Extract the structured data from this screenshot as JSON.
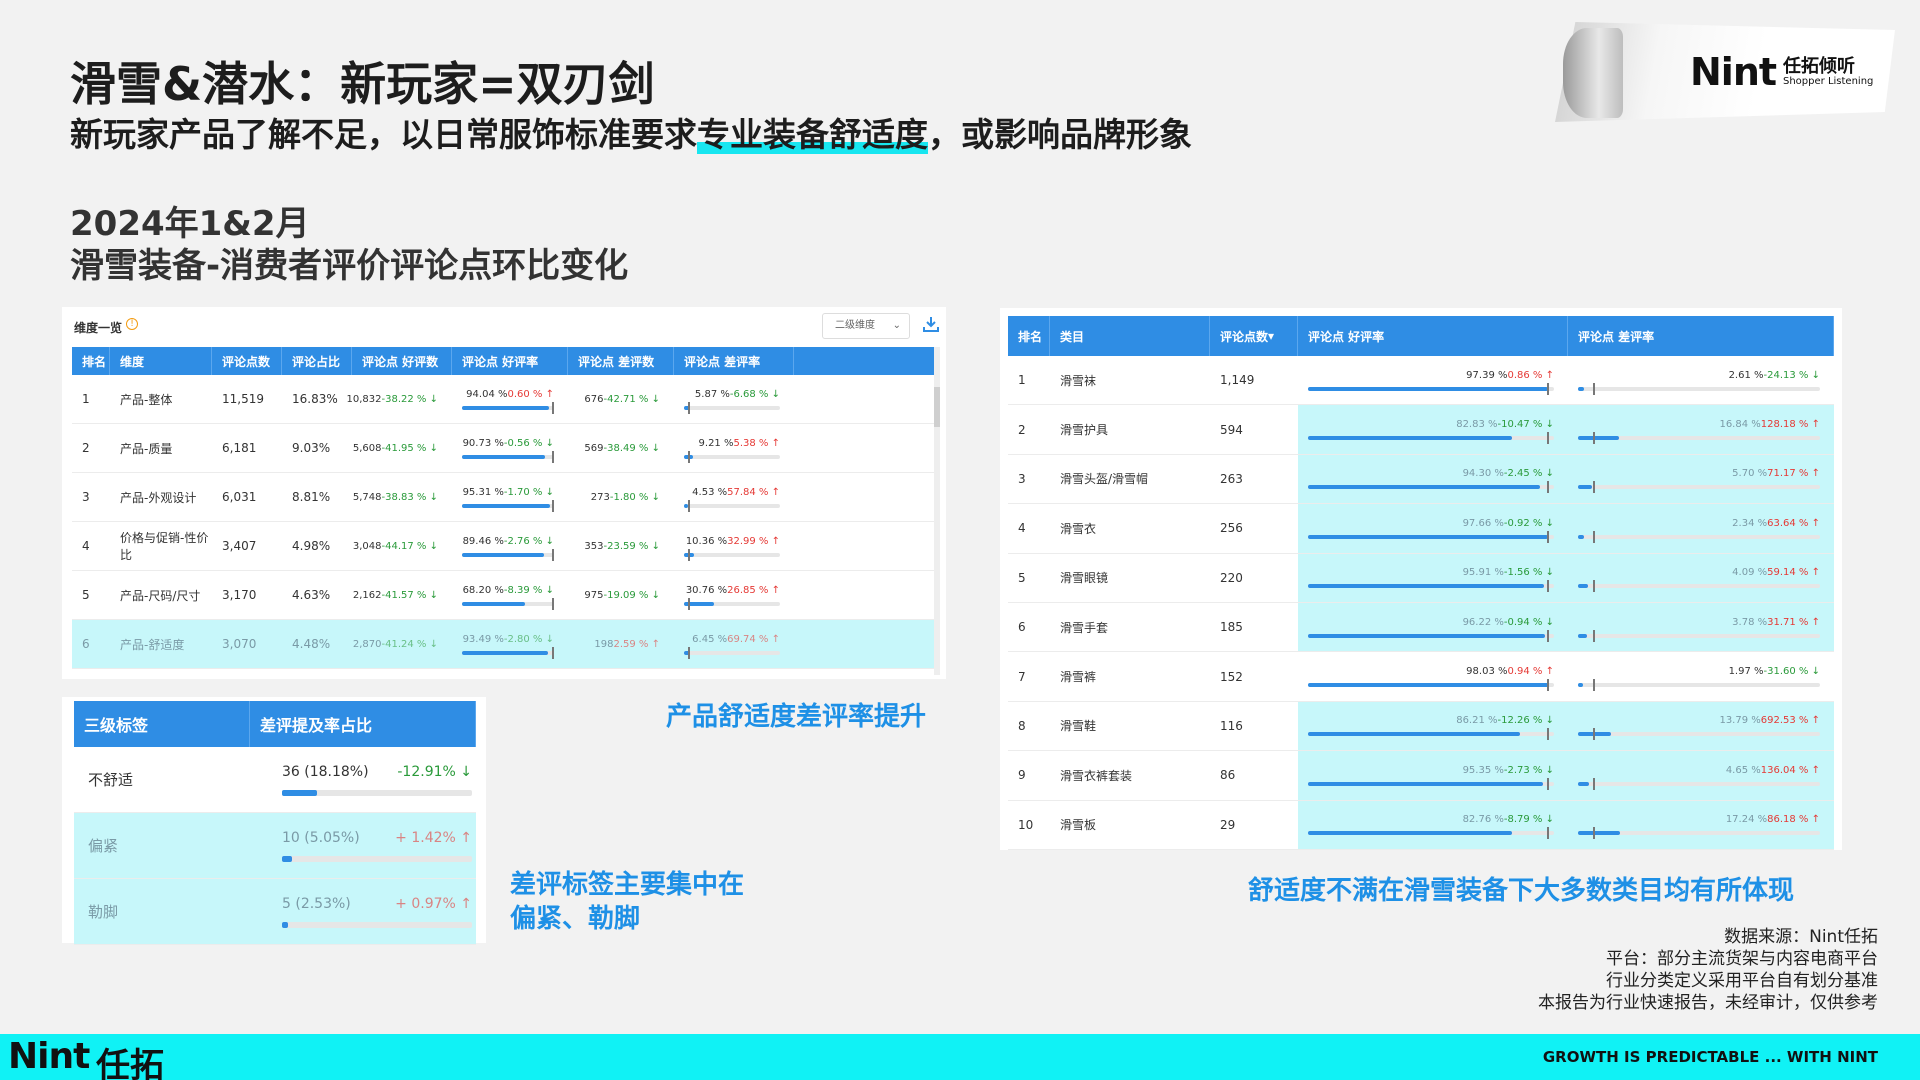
{
  "header": {
    "title": "滑雪&潜水：新玩家=双刃剑",
    "subtitle_pre": "新玩家产品了解不足，以日常服饰标准要求",
    "subtitle_hl": "专业装备舒适度",
    "subtitle_post": "，或影响品牌形象",
    "period": "2024年1&2月",
    "section": "滑雪装备-消费者评价评论点环比变化"
  },
  "logo": {
    "brand": "Nint",
    "cn": "任拓倾听",
    "en": "Shopper Listening"
  },
  "left_table": {
    "toolbar_title": "维度一览",
    "info_icon": "info-icon",
    "select_label": "二级维度",
    "download_icon": "download-icon",
    "columns": [
      "排名",
      "维度",
      "评论点数",
      "评论占比",
      "评论点 好评数",
      "评论点 好评率",
      "评论点 差评数",
      "评论点 差评率"
    ],
    "rows": [
      {
        "rank": "1",
        "dim": "产品-整体",
        "count": "11,519",
        "share": "16.83%",
        "good": "10,832",
        "good_chg": "-38.22 % ↓",
        "good_rate": "94.04 %",
        "good_rate_chg": "0.60 % ↑",
        "good_rate_val": 94.04,
        "bad": "676",
        "bad_chg": "-42.71 % ↓",
        "bad_rate": "5.87 %",
        "bad_rate_chg": "-6.68 % ↓",
        "bad_rate_val": 5.87
      },
      {
        "rank": "2",
        "dim": "产品-质量",
        "count": "6,181",
        "share": "9.03%",
        "good": "5,608",
        "good_chg": "-41.95 % ↓",
        "good_rate": "90.73 %",
        "good_rate_chg": "-0.56 % ↓",
        "good_rate_val": 90.73,
        "bad": "569",
        "bad_chg": "-38.49 % ↓",
        "bad_rate": "9.21 %",
        "bad_rate_chg": "5.38 % ↑",
        "bad_rate_val": 9.21
      },
      {
        "rank": "3",
        "dim": "产品-外观设计",
        "count": "6,031",
        "share": "8.81%",
        "good": "5,748",
        "good_chg": "-38.83 % ↓",
        "good_rate": "95.31 %",
        "good_rate_chg": "-1.70 % ↓",
        "good_rate_val": 95.31,
        "bad": "273",
        "bad_chg": "-1.80 % ↓",
        "bad_rate": "4.53 %",
        "bad_rate_chg": "57.84 % ↑",
        "bad_rate_val": 4.53
      },
      {
        "rank": "4",
        "dim": "价格与促销-性价比",
        "count": "3,407",
        "share": "4.98%",
        "good": "3,048",
        "good_chg": "-44.17 % ↓",
        "good_rate": "89.46 %",
        "good_rate_chg": "-2.76 % ↓",
        "good_rate_val": 89.46,
        "bad": "353",
        "bad_chg": "-23.59 % ↓",
        "bad_rate": "10.36 %",
        "bad_rate_chg": "32.99 % ↑",
        "bad_rate_val": 10.36
      },
      {
        "rank": "5",
        "dim": "产品-尺码/尺寸",
        "count": "3,170",
        "share": "4.63%",
        "good": "2,162",
        "good_chg": "-41.57 % ↓",
        "good_rate": "68.20 %",
        "good_rate_chg": "-8.39 % ↓",
        "good_rate_val": 68.2,
        "bad": "975",
        "bad_chg": "-19.09 % ↓",
        "bad_rate": "30.76 %",
        "bad_rate_chg": "26.85 % ↑",
        "bad_rate_val": 30.76
      },
      {
        "rank": "6",
        "dim": "产品-舒适度",
        "count": "3,070",
        "share": "4.48%",
        "good": "2,870",
        "good_chg": "-41.24 % ↓",
        "good_rate": "93.49 %",
        "good_rate_chg": "-2.80 % ↓",
        "good_rate_val": 93.49,
        "bad": "198",
        "bad_chg": "2.59 % ↑",
        "bad_rate": "6.45 %",
        "bad_rate_chg": "69.74 % ↑",
        "bad_rate_val": 6.45,
        "highlight": true
      }
    ]
  },
  "right_table": {
    "columns": [
      "排名",
      "类目",
      "评论点数",
      "评论点 好评率",
      "评论点 差评率"
    ],
    "sort_icon": "sort-desc-icon",
    "rows": [
      {
        "rank": "1",
        "cat": "滑雪袜",
        "count": "1,149",
        "good_rate": "97.39 %",
        "good_chg": "0.86 % ↑",
        "good_val": 97.39,
        "bad_rate": "2.61 %",
        "bad_chg": "-24.13 % ↓",
        "bad_val": 2.61
      },
      {
        "rank": "2",
        "cat": "滑雪护具",
        "count": "594",
        "good_rate": "82.83 %",
        "good_chg": "-10.47 % ↓",
        "good_val": 82.83,
        "bad_rate": "16.84 %",
        "bad_chg": "128.18 % ↑",
        "bad_val": 16.84,
        "highlight": true
      },
      {
        "rank": "3",
        "cat": "滑雪头盔/滑雪帽",
        "count": "263",
        "good_rate": "94.30 %",
        "good_chg": "-2.45 % ↓",
        "good_val": 94.3,
        "bad_rate": "5.70 %",
        "bad_chg": "71.17 % ↑",
        "bad_val": 5.7,
        "highlight": true
      },
      {
        "rank": "4",
        "cat": "滑雪衣",
        "count": "256",
        "good_rate": "97.66 %",
        "good_chg": "-0.92 % ↓",
        "good_val": 97.66,
        "bad_rate": "2.34 %",
        "bad_chg": "63.64 % ↑",
        "bad_val": 2.34,
        "highlight": true
      },
      {
        "rank": "5",
        "cat": "滑雪眼镜",
        "count": "220",
        "good_rate": "95.91 %",
        "good_chg": "-1.56 % ↓",
        "good_val": 95.91,
        "bad_rate": "4.09 %",
        "bad_chg": "59.14 % ↑",
        "bad_val": 4.09,
        "highlight": true
      },
      {
        "rank": "6",
        "cat": "滑雪手套",
        "count": "185",
        "good_rate": "96.22 %",
        "good_chg": "-0.94 % ↓",
        "good_val": 96.22,
        "bad_rate": "3.78 %",
        "bad_chg": "31.71 % ↑",
        "bad_val": 3.78,
        "highlight": true
      },
      {
        "rank": "7",
        "cat": "滑雪裤",
        "count": "152",
        "good_rate": "98.03 %",
        "good_chg": "0.94 % ↑",
        "good_val": 98.03,
        "bad_rate": "1.97 %",
        "bad_chg": "-31.60 % ↓",
        "bad_val": 1.97
      },
      {
        "rank": "8",
        "cat": "滑雪鞋",
        "count": "116",
        "good_rate": "86.21 %",
        "good_chg": "-12.26 % ↓",
        "good_val": 86.21,
        "bad_rate": "13.79 %",
        "bad_chg": "692.53 % ↑",
        "bad_val": 13.79,
        "highlight": true
      },
      {
        "rank": "9",
        "cat": "滑雪衣裤套装",
        "count": "86",
        "good_rate": "95.35 %",
        "good_chg": "-2.73 % ↓",
        "good_val": 95.35,
        "bad_rate": "4.65 %",
        "bad_chg": "136.04 % ↑",
        "bad_val": 4.65,
        "highlight": true
      },
      {
        "rank": "10",
        "cat": "滑雪板",
        "count": "29",
        "good_rate": "82.76 %",
        "good_chg": "-8.79 % ↓",
        "good_val": 82.76,
        "bad_rate": "17.24 %",
        "bad_chg": "86.18 % ↑",
        "bad_val": 17.24,
        "highlight": true
      }
    ]
  },
  "bottom_table": {
    "columns": [
      "三级标签",
      "差评提及率占比"
    ],
    "rows": [
      {
        "tag": "不舒适",
        "value": "36 (18.18%)",
        "chg": "-12.91% ↓",
        "dir": "down",
        "pct": 18.18
      },
      {
        "tag": "偏紧",
        "value": "10 (5.05%)",
        "chg": "+ 1.42% ↑",
        "dir": "up",
        "pct": 5.05,
        "highlight": true
      },
      {
        "tag": "勒脚",
        "value": "5 (2.53%)",
        "chg": "+ 0.97% ↑",
        "dir": "up",
        "pct": 2.53,
        "highlight": true
      }
    ]
  },
  "notes": {
    "comfort": "产品舒适度差评率提升",
    "tags_line1": "差评标签主要集中在",
    "tags_line2": "偏紧、勒脚",
    "categories": "舒适度不满在滑雪装备下大多数类目均有所体现"
  },
  "source": {
    "line1": "数据来源：Nint任拓",
    "line2": "平台：部分主流货架与内容电商平台",
    "line3": "行业分类定义采用平台自有划分基准",
    "line4": "本报告为行业快速报告，未经审计，仅供参考"
  },
  "footer": {
    "brand": "Nint",
    "brand_cn": "任拓",
    "slogan": "GROWTH IS PREDICTABLE ... WITH NINT"
  },
  "colors": {
    "accent": "#2f8de4",
    "highlight": "#c7f7fa",
    "footer": "#10f2f5",
    "note": "#1e90e6",
    "up": "#e53935",
    "down": "#2a9a3a"
  }
}
